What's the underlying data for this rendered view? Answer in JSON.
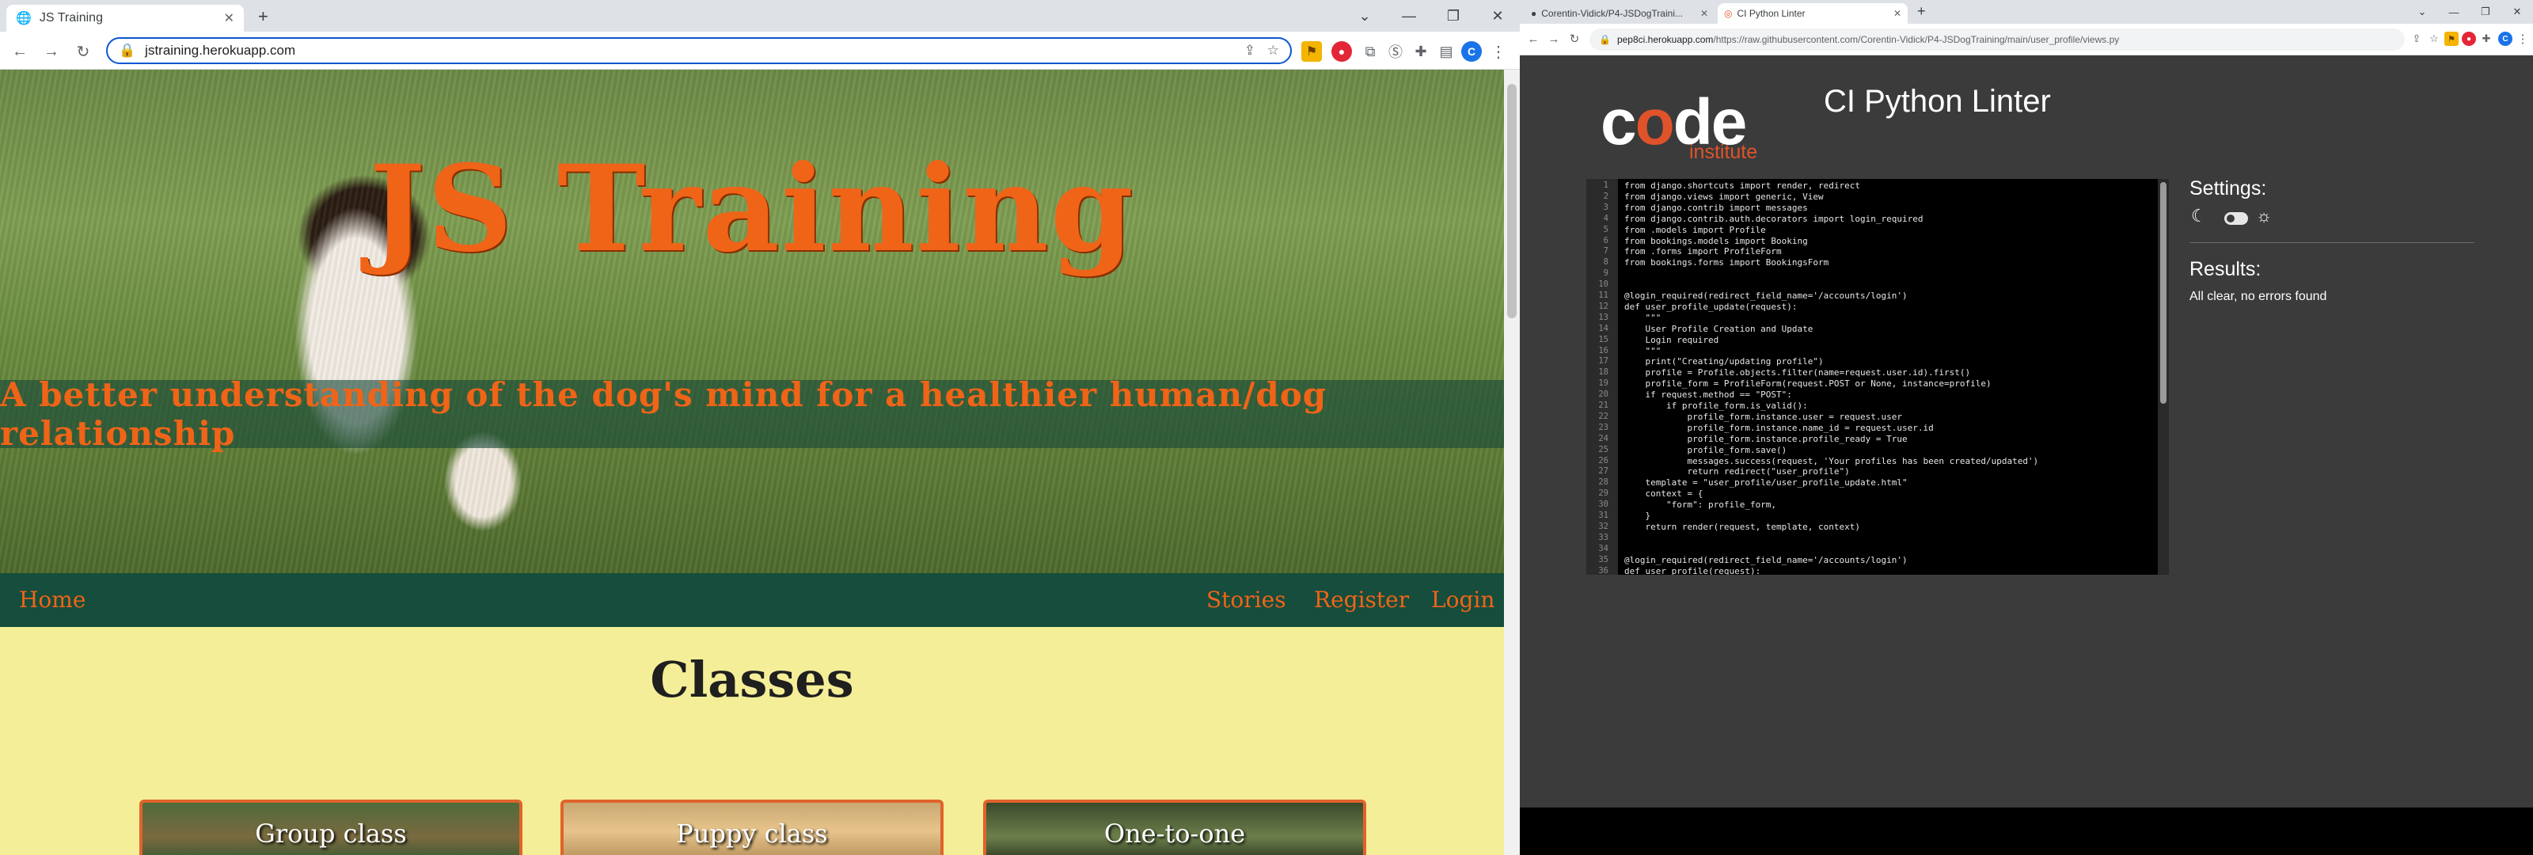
{
  "left_window": {
    "tab_title": "JS Training",
    "url": "jstraining.herokuapp.com",
    "avatar_letter": "C",
    "hero": {
      "title": "JS Training",
      "tagline": "A better understanding of the dog's mind for a healthier human/dog relationship"
    },
    "nav": {
      "home": "Home",
      "stories": "Stories",
      "register": "Register",
      "login": "Login"
    },
    "section_title": "Classes",
    "cards": [
      "Group class",
      "Puppy class",
      "One-to-one"
    ],
    "accent_color": "#f06418",
    "nav_color": "#164d3c",
    "bg_color": "#f5ee98"
  },
  "right_window": {
    "tabs": [
      "Corentin-Vidick/P4-JSDogTraini...",
      "CI Python Linter"
    ],
    "url_host": "pep8ci.herokuapp.com",
    "url_path": "/https://raw.githubusercontent.com/Corentin-Vidick/P4-JSDogTraining/main/user_profile/views.py",
    "avatar_letter": "C",
    "logo": {
      "part1": "c",
      "o": "o",
      "part2": "de",
      "sub": "institute"
    },
    "title": "CI Python Linter",
    "settings_label": "Settings:",
    "results_label": "Results:",
    "results_text": "All clear, no errors found",
    "code_lines": [
      "from django.shortcuts import render, redirect",
      "from django.views import generic, View",
      "from django.contrib import messages",
      "from django.contrib.auth.decorators import login_required",
      "from .models import Profile",
      "from bookings.models import Booking",
      "from .forms import ProfileForm",
      "from bookings.forms import BookingsForm",
      "",
      "",
      "@login_required(redirect_field_name='/accounts/login')",
      "def user_profile_update(request):",
      "    \"\"\"",
      "    User Profile Creation and Update",
      "    Login required",
      "    \"\"\"",
      "    print(\"Creating/updating profile\")",
      "    profile = Profile.objects.filter(name=request.user.id).first()",
      "    profile_form = ProfileForm(request.POST or None, instance=profile)",
      "    if request.method == \"POST\":",
      "        if profile_form.is_valid():",
      "            profile_form.instance.user = request.user",
      "            profile_form.instance.name_id = request.user.id",
      "            profile_form.instance.profile_ready = True",
      "            profile_form.save()",
      "            messages.success(request, 'Your profiles has been created/updated')",
      "            return redirect(\"user_profile\")",
      "    template = \"user_profile/user_profile_update.html\"",
      "    context = {",
      "        \"form\": profile_form,",
      "    }",
      "    return render(request, template, context)",
      "",
      "",
      "@login_required(redirect_field_name='/accounts/login')",
      "def user_profile(request):"
    ],
    "line_numbers": [
      "1",
      "2",
      "3",
      "4",
      "5",
      "6",
      "7",
      "8",
      "9",
      "10",
      "11",
      "12",
      "13",
      "14",
      "15",
      "16",
      "17",
      "18",
      "19",
      "20",
      "21",
      "22",
      "23",
      "24",
      "25",
      "26",
      "27",
      "28",
      "29",
      "30",
      "31",
      "32",
      "33",
      "34",
      "35",
      "36"
    ]
  }
}
